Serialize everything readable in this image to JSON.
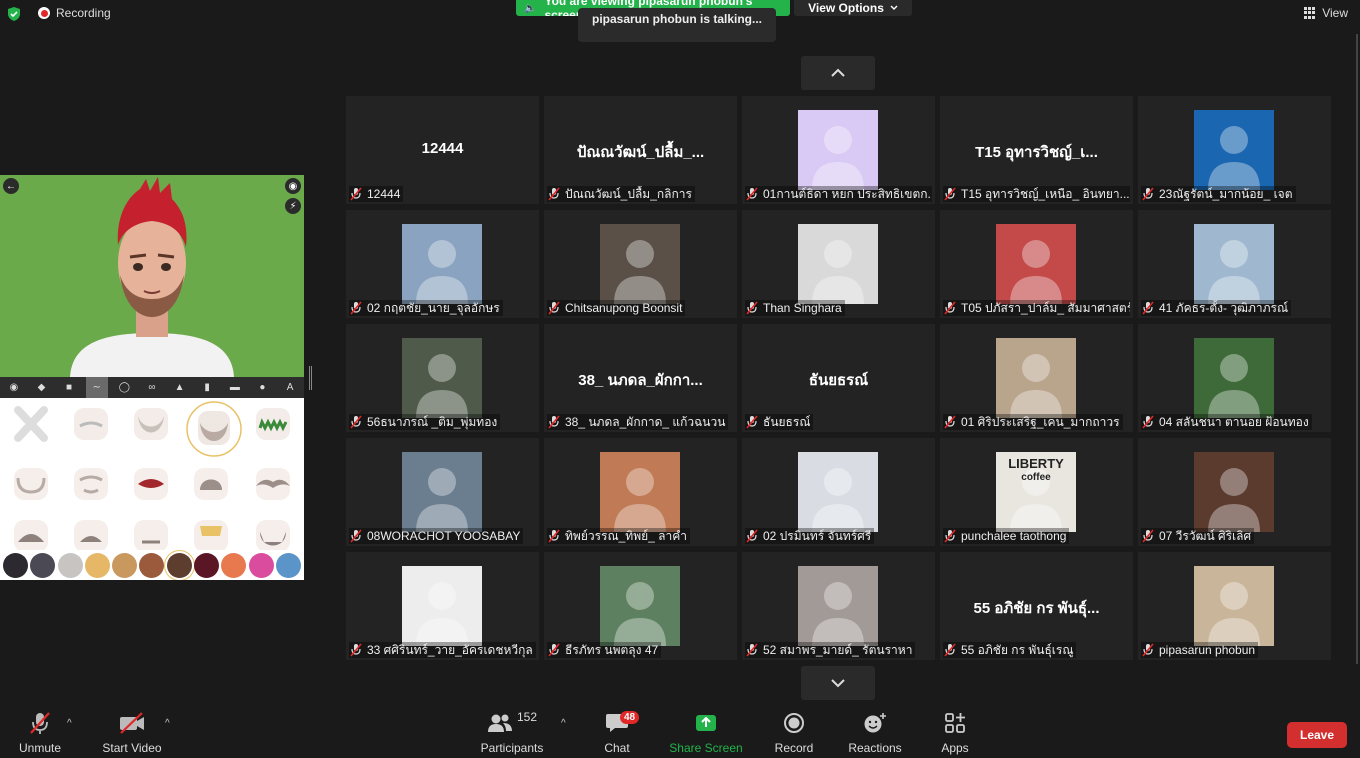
{
  "top": {
    "recording_label": "Recording",
    "viewing_banner": "You are viewing pipasarun phobun's screen",
    "view_options_label": "View Options",
    "talking_indicator": "pipasarun phobun is talking...",
    "view_label": "View"
  },
  "colors": {
    "background": "#1a1a1a",
    "tile": "#232323",
    "banner_green": "#23b34a",
    "leave_red": "#d32f2f",
    "avatar_bg": "#6aaa4b"
  },
  "share_panel": {
    "color_swatches": [
      "#2c2a30",
      "#4a4954",
      "#c7c4c2",
      "#e5b766",
      "#c9985f",
      "#9b5a3c",
      "#5c3d2e",
      "#5b1626",
      "#e8794f",
      "#d94c9e",
      "#5b94c9"
    ],
    "selected_swatch_index": 6
  },
  "tiles": [
    {
      "name": "12444",
      "display": "12444",
      "kind": "text"
    },
    {
      "name": "ปัณณวัฒน์_ปลื้ม_กลิการ",
      "display": "ปัณณวัฒน์_ปลื้ม_...",
      "kind": "text"
    },
    {
      "name": "01กานต์ธิดา หยก ประสิทธิเขตก...",
      "kind": "photo",
      "bg": "#d9c9f5"
    },
    {
      "name": "T15 อุทารวิชญ์_เหนือ_ อินทยา...",
      "display": "T15 อุทารวิชญ์_เ...",
      "kind": "text"
    },
    {
      "name": "23ณัฐรัตน์_มากน้อย_ เจต",
      "kind": "photo",
      "bg": "#1a66b0"
    },
    {
      "name": "02 กฤตชัย_นาย_จุลอักษร",
      "kind": "photo",
      "bg": "#8aa3c0"
    },
    {
      "name": "Chitsanupong Boonsit",
      "kind": "photo",
      "bg": "#5a5048"
    },
    {
      "name": "Than Singhara",
      "kind": "photo",
      "bg": "#d9d9d9"
    },
    {
      "name": "T05 ปภัสรา_ปาล์ม_ สัมมาศาสตร์",
      "kind": "photo",
      "bg": "#c44a4a"
    },
    {
      "name": "41 ภัคธร-ตั้ง- วุฒิภาภรณ์",
      "kind": "photo",
      "bg": "#9fb8cf"
    },
    {
      "name": "56ธนาภรณ์ _ติม_พุ่มทอง",
      "kind": "photo",
      "bg": "#4f5a4a"
    },
    {
      "name": "38_ นภดล_ผักกาด_ แก้วฉนวน",
      "display": "38_ นภดล_ผักกา...",
      "kind": "text"
    },
    {
      "name": "ธันยธรณ์",
      "display": "ธันยธรณ์",
      "kind": "text"
    },
    {
      "name": "01 ศิริประเสริฐ_เคน_มากถาวร",
      "kind": "photo",
      "bg": "#b9a58c"
    },
    {
      "name": "04 สลันชนา ตานอย ฝ้อนทอง",
      "kind": "photo",
      "bg": "#3e6a3a"
    },
    {
      "name": "08WORACHOT YOOSABAY",
      "kind": "photo",
      "bg": "#6b7e8f"
    },
    {
      "name": "ทิพย์วรรณ_ทิพย์_ ลาคำ",
      "kind": "photo",
      "bg": "#c07a55"
    },
    {
      "name": "02 ปรมินทร์ จันทร์ศรี",
      "kind": "photo",
      "bg": "#d9dde3"
    },
    {
      "name": "punchalee taothong",
      "kind": "photo",
      "bg": "#e9e6e0",
      "photo_text": [
        "LIBERTY",
        "coffee"
      ]
    },
    {
      "name": "07 วีรวัฒน์ ศิริเลิศ",
      "kind": "photo",
      "bg": "#5a3b2e"
    },
    {
      "name": "33 ศศิรินทร์_วาย_อัครเดชหวีกุล",
      "kind": "photo",
      "bg": "#ededed"
    },
    {
      "name": "ธีรภัทร นพตลุง 47",
      "kind": "photo",
      "bg": "#5d8060"
    },
    {
      "name": "52 สมาพร_มายด์_ รัตนราหา",
      "kind": "photo",
      "bg": "#a29a96"
    },
    {
      "name": "55 อภิชัย กร พันธุ์เรณู",
      "display": "55 อภิชัย กร พันธุ์...",
      "kind": "text"
    },
    {
      "name": "pipasarun phobun",
      "kind": "photo",
      "bg": "#c9b59a"
    }
  ],
  "bottom_bar": {
    "unmute": "Unmute",
    "start_video": "Start Video",
    "participants": "Participants",
    "participants_count": "152",
    "chat": "Chat",
    "chat_badge": "48",
    "share_screen": "Share Screen",
    "record": "Record",
    "reactions": "Reactions",
    "apps": "Apps",
    "leave": "Leave"
  }
}
